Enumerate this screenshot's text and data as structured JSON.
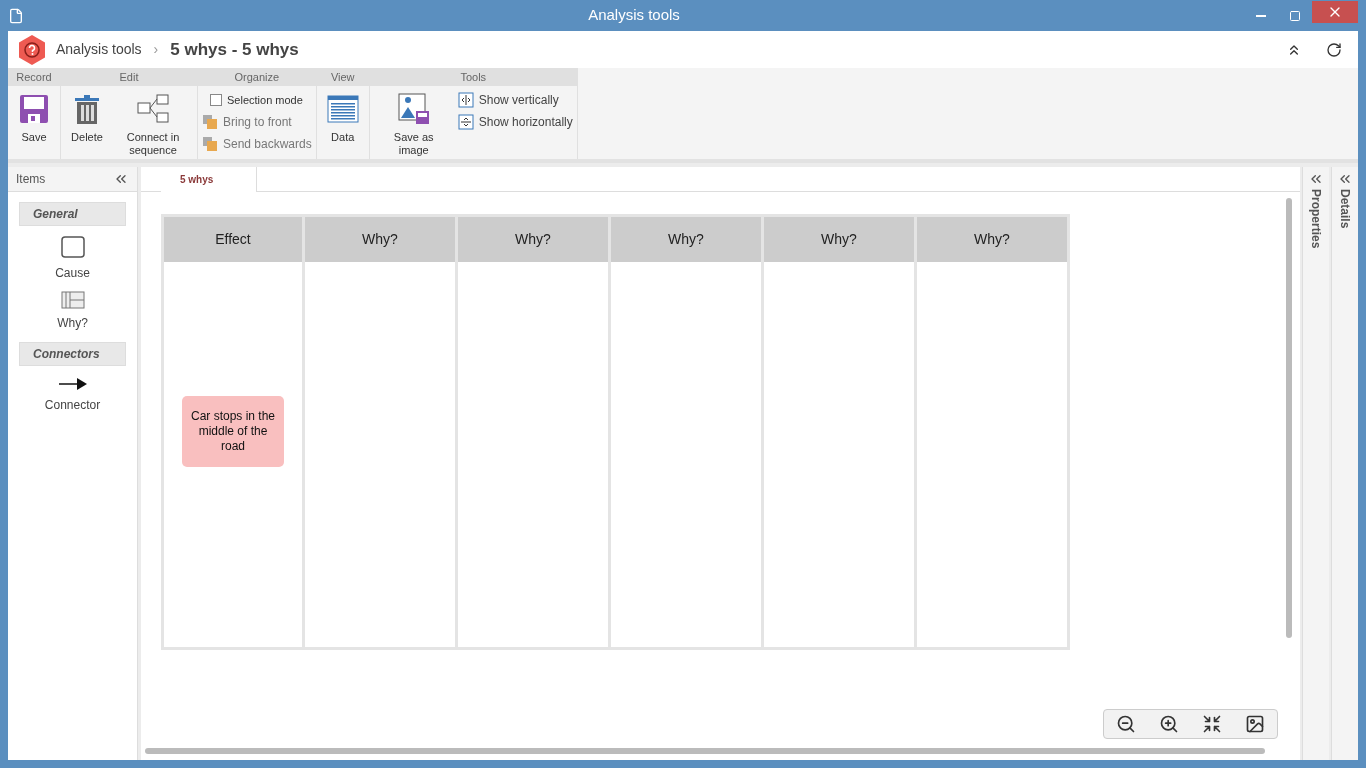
{
  "window": {
    "title": "Analysis tools"
  },
  "breadcrumb": {
    "parent": "Analysis tools",
    "separator": "›",
    "current": "5 whys - 5 whys"
  },
  "ribbon": [
    {
      "title": "Record",
      "items": [
        {
          "kind": "big",
          "label": "Save"
        }
      ]
    },
    {
      "title": "Edit",
      "items": [
        {
          "kind": "big",
          "label": "Delete"
        },
        {
          "kind": "big",
          "label": "Connect in sequence"
        }
      ]
    },
    {
      "title": "Organize",
      "items": [
        {
          "kind": "check",
          "label": "Selection mode",
          "checked": false
        },
        {
          "kind": "small",
          "label": "Bring to front",
          "disabled": true
        },
        {
          "kind": "small",
          "label": "Send backwards",
          "disabled": true
        }
      ]
    },
    {
      "title": "View",
      "items": [
        {
          "kind": "big",
          "label": "Data"
        }
      ]
    },
    {
      "title": "Tools",
      "items": [
        {
          "kind": "big",
          "label": "Save as image"
        },
        {
          "kind": "small",
          "label": "Show vertically",
          "disabled": false
        },
        {
          "kind": "small",
          "label": "Show horizontally",
          "disabled": false
        }
      ]
    }
  ],
  "items_panel": {
    "title": "Items",
    "groups": [
      {
        "title": "General",
        "items": [
          {
            "label": "Cause"
          },
          {
            "label": "Why?"
          }
        ]
      },
      {
        "title": "Connectors",
        "items": [
          {
            "label": "Connector"
          }
        ]
      }
    ]
  },
  "tabs": [
    {
      "label": "5 whys",
      "selected": true
    }
  ],
  "diagram": {
    "columns": [
      "Effect",
      "Why?",
      "Why?",
      "Why?",
      "Why?",
      "Why?"
    ],
    "cause_note": "Car stops in the middle of the road"
  },
  "side_panels": [
    "Properties",
    "Details"
  ]
}
